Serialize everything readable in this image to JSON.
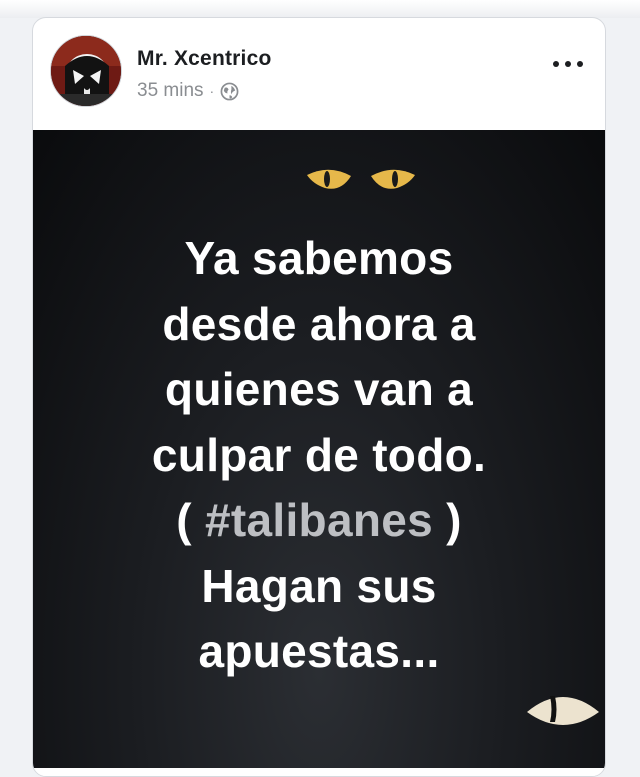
{
  "post": {
    "author": "Mr. Xcentrico",
    "timestamp": "35 mins",
    "separator": "·",
    "privacy_icon": "globe-icon",
    "more_icon": "more-dots-icon",
    "text": {
      "line1": "Ya sabemos",
      "line2": "desde ahora a",
      "line3": "quienes van a",
      "line4": "culpar de todo.",
      "line5_open": "( ",
      "hashtag": "#talibanes",
      "line5_close": " )",
      "line6": "Hagan sus",
      "line7": "apuestas..."
    }
  },
  "colors": {
    "author_text": "#1c1e21",
    "meta_text": "#8a8d91",
    "post_background": "#1b1d21",
    "post_text": "#ffffff",
    "hashtag_text": "#bdbfc3",
    "eye_color": "#e6b84a"
  }
}
